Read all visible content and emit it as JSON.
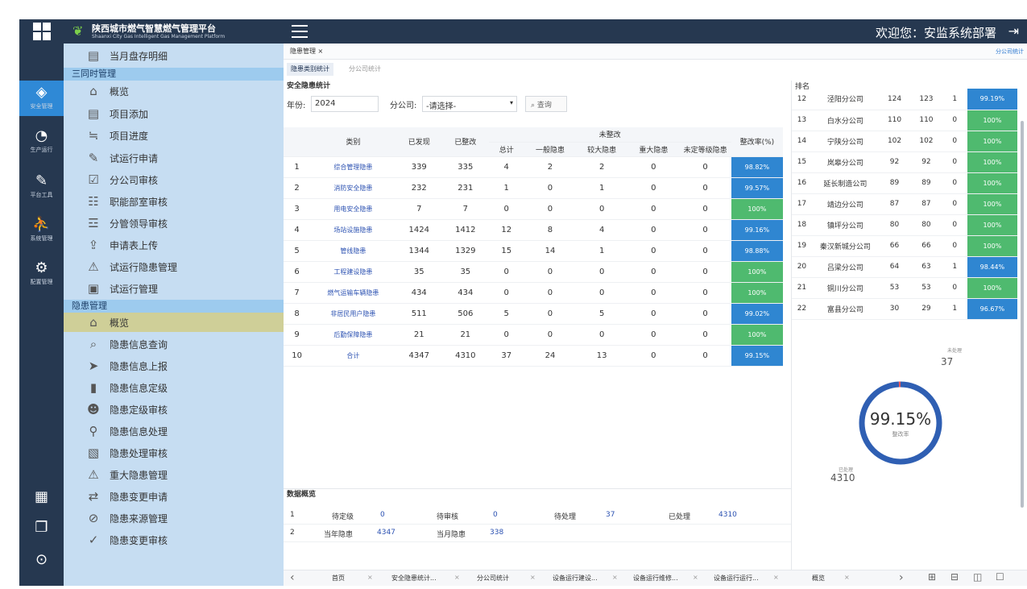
{
  "topbar": {
    "brand_title": "陕西城市燃气智慧燃气管理平台",
    "brand_subtitle": "Shaanxi City Gas Intelligent Gas Management Platform",
    "welcome": "欢迎您：安监系统部署"
  },
  "rail": [
    {
      "icon": "location-icon",
      "label": "安全管理",
      "active": true
    },
    {
      "icon": "chart-icon",
      "label": "生产运行",
      "active": false
    },
    {
      "icon": "wrench-icon",
      "label": "平台工具",
      "active": false
    },
    {
      "icon": "user-icon",
      "label": "系统管理",
      "active": false
    },
    {
      "icon": "settings-icon",
      "label": "配置管理",
      "active": false
    }
  ],
  "menu": {
    "items_a": [
      "当月盘存明细"
    ],
    "group1": "三同时管理",
    "items_b": [
      "概览",
      "项目添加",
      "项目进度",
      "试运行申请",
      "分公司审核",
      "职能部室审核",
      "分管领导审核",
      "申请表上传",
      "试运行隐患管理",
      "试运行管理"
    ],
    "group2": "隐患管理",
    "items_c": [
      "概览",
      "隐患信息查询",
      "隐患信息上报",
      "隐患信息定级",
      "隐患定级审核",
      "隐患信息处理",
      "隐患处理审核",
      "重大隐患管理",
      "隐患变更申请",
      "隐患来源管理",
      "隐患变更审核"
    ]
  },
  "main": {
    "breadcrumb": "隐患管理 ×",
    "bc_right": "分公司统计",
    "subtabs": [
      "隐患类别统计",
      "分公司统计"
    ],
    "panel_title": "安全隐患统计",
    "filter": {
      "year_label": "年份:",
      "year": "2024",
      "company_label": "分公司:",
      "company": "-请选择-",
      "search": "查询"
    },
    "table": {
      "headers": [
        "类别",
        "已发现",
        "已整改",
        "未整改",
        "整改率(%)"
      ],
      "sub_headers": [
        "总计",
        "一般隐患",
        "较大隐患",
        "重大隐患",
        "未定等级隐患"
      ],
      "rows": [
        {
          "n": "1",
          "name": "综合管理隐患",
          "found": "339",
          "fixed": "335",
          "total": "4",
          "general": "2",
          "larger": "2",
          "major": "0",
          "undef": "0",
          "rate": "98.82%",
          "c": "b"
        },
        {
          "n": "2",
          "name": "消防安全隐患",
          "found": "232",
          "fixed": "231",
          "total": "1",
          "general": "0",
          "larger": "1",
          "major": "0",
          "undef": "0",
          "rate": "99.57%",
          "c": "b"
        },
        {
          "n": "3",
          "name": "用电安全隐患",
          "found": "7",
          "fixed": "7",
          "total": "0",
          "general": "0",
          "larger": "0",
          "major": "0",
          "undef": "0",
          "rate": "100%",
          "c": "g"
        },
        {
          "n": "4",
          "name": "场站设施隐患",
          "found": "1424",
          "fixed": "1412",
          "total": "12",
          "general": "8",
          "larger": "4",
          "major": "0",
          "undef": "0",
          "rate": "99.16%",
          "c": "b"
        },
        {
          "n": "5",
          "name": "管线隐患",
          "found": "1344",
          "fixed": "1329",
          "total": "15",
          "general": "14",
          "larger": "1",
          "major": "0",
          "undef": "0",
          "rate": "98.88%",
          "c": "b"
        },
        {
          "n": "6",
          "name": "工程建设隐患",
          "found": "35",
          "fixed": "35",
          "total": "0",
          "general": "0",
          "larger": "0",
          "major": "0",
          "undef": "0",
          "rate": "100%",
          "c": "g"
        },
        {
          "n": "7",
          "name": "燃气运输车辆隐患",
          "found": "434",
          "fixed": "434",
          "total": "0",
          "general": "0",
          "larger": "0",
          "major": "0",
          "undef": "0",
          "rate": "100%",
          "c": "g"
        },
        {
          "n": "8",
          "name": "非居民用户隐患",
          "found": "511",
          "fixed": "506",
          "total": "5",
          "general": "0",
          "larger": "5",
          "major": "0",
          "undef": "0",
          "rate": "99.02%",
          "c": "b"
        },
        {
          "n": "9",
          "name": "后勤保障隐患",
          "found": "21",
          "fixed": "21",
          "total": "0",
          "general": "0",
          "larger": "0",
          "major": "0",
          "undef": "0",
          "rate": "100%",
          "c": "g"
        },
        {
          "n": "10",
          "name": "合计",
          "found": "4347",
          "fixed": "4310",
          "total": "37",
          "general": "24",
          "larger": "13",
          "major": "0",
          "undef": "0",
          "rate": "99.15%",
          "c": "b"
        }
      ]
    },
    "summary": {
      "title": "数据概览",
      "row1": [
        {
          "k": "1"
        },
        {
          "k": "待定级",
          "v": "0"
        },
        {
          "k": "待审核",
          "v": "0"
        },
        {
          "k": "待处理",
          "v": "37"
        },
        {
          "k": "已处理",
          "v": "4310"
        }
      ],
      "row2": [
        {
          "k": "2"
        },
        {
          "k": "当年隐患",
          "v": "4347"
        },
        {
          "k": "当月隐患",
          "v": "338"
        }
      ]
    },
    "ranking": {
      "title": "排名",
      "rows": [
        {
          "n": "12",
          "name": "泾阳分公司",
          "a": "124",
          "b": "123",
          "c": "1",
          "rate": "99.19%",
          "col": "b"
        },
        {
          "n": "13",
          "name": "白水分公司",
          "a": "110",
          "b": "110",
          "c": "0",
          "rate": "100%",
          "col": "g"
        },
        {
          "n": "14",
          "name": "宁陕分公司",
          "a": "102",
          "b": "102",
          "c": "0",
          "rate": "100%",
          "col": "g"
        },
        {
          "n": "15",
          "name": "岚皋分公司",
          "a": "92",
          "b": "92",
          "c": "0",
          "rate": "100%",
          "col": "g"
        },
        {
          "n": "16",
          "name": "延长制造公司",
          "a": "89",
          "b": "89",
          "c": "0",
          "rate": "100%",
          "col": "g"
        },
        {
          "n": "17",
          "name": "靖边分公司",
          "a": "87",
          "b": "87",
          "c": "0",
          "rate": "100%",
          "col": "g"
        },
        {
          "n": "18",
          "name": "镇坪分公司",
          "a": "80",
          "b": "80",
          "c": "0",
          "rate": "100%",
          "col": "g"
        },
        {
          "n": "19",
          "name": "秦汉新城分公司",
          "a": "66",
          "b": "66",
          "c": "0",
          "rate": "100%",
          "col": "g"
        },
        {
          "n": "20",
          "name": "吕梁分公司",
          "a": "64",
          "b": "63",
          "c": "1",
          "rate": "98.44%",
          "col": "b"
        },
        {
          "n": "21",
          "name": "铜川分公司",
          "a": "53",
          "b": "53",
          "c": "0",
          "rate": "100%",
          "col": "g"
        },
        {
          "n": "22",
          "name": "富县分公司",
          "a": "30",
          "b": "29",
          "c": "1",
          "rate": "96.67%",
          "col": "b"
        }
      ]
    },
    "donut": {
      "pct": "99.15%",
      "sub": "整改率",
      "unfixed_label": "未处理",
      "unfixed": "37",
      "fixed_label": "已处理",
      "fixed": "4310",
      "rate": 0.9915,
      "color": "#2f5fb3"
    },
    "bottom_tabs": [
      "首页",
      "安全隐患统计...",
      "分公司统计",
      "设备运行建设...",
      "设备运行维修...",
      "设备运行运行...",
      "概览"
    ]
  }
}
